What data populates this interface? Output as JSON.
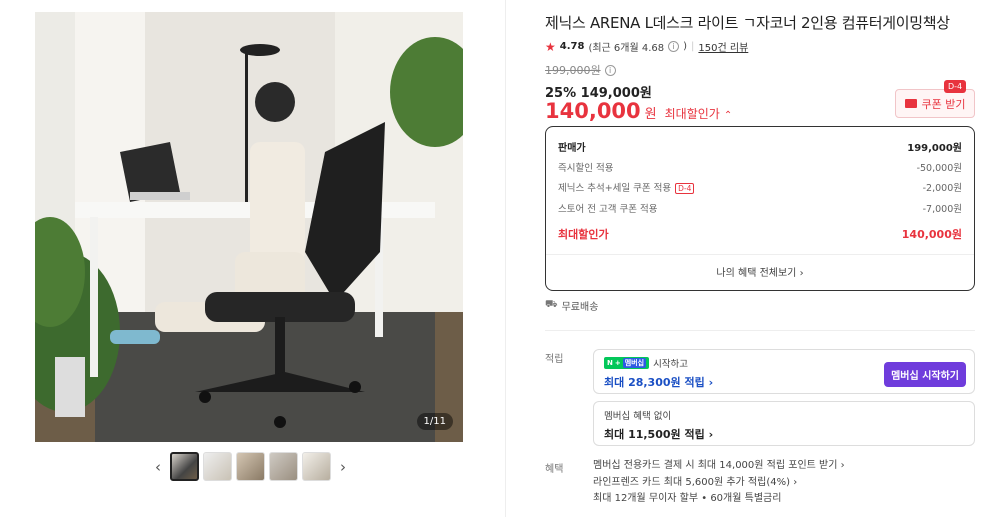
{
  "gallery": {
    "counter": "1/11",
    "prev_icon": "‹",
    "next_icon": "›",
    "thumb_count": 5
  },
  "product": {
    "title": "제닉스 ARENA L데스크 라이트 ㄱ자코너 2인용 컴퓨터게이밍책상",
    "rating": "4.78",
    "rating_recent": "(최근 6개월 4.68",
    "rating_recent_close": ")",
    "review_count": "150건 리뷰",
    "original_price": "199,000원",
    "discount_percent": "25%",
    "discount_price": "149,000원",
    "final_price": "140,000",
    "final_won": "원",
    "final_label": "최대할인가"
  },
  "coupon": {
    "label": "쿠폰 받기",
    "badge": "D-4"
  },
  "price_box": {
    "rows": [
      {
        "label": "판매가",
        "value": "199,000원"
      },
      {
        "label": "즉시할인 적용",
        "value": "-50,000원"
      },
      {
        "label": "제닉스 추석+세일 쿠폰 적용",
        "tag": "D-4",
        "value": "-2,000원"
      },
      {
        "label": "스토어 전 고객 쿠폰 적용",
        "value": "-7,000원"
      }
    ],
    "max_label": "최대할인가",
    "max_value": "140,000원",
    "footer": "나의 혜택 전체보기"
  },
  "shipping": {
    "label": "무료배송"
  },
  "points": {
    "label": "적립",
    "card1_small": "시작하고",
    "card1_badge_n": "N",
    "card1_badge_plus": "+",
    "card1_badge_mem": "멤버십",
    "card1_big": "최대 28,300원 적립",
    "card1_button": "멤버십 시작하기",
    "card2_small": "멤버십 혜택 없이",
    "card2_big": "최대 11,500원 적립"
  },
  "benefits": {
    "label": "혜택",
    "lines": [
      "멤버십 전용카드 결제 시 최대 14,000원 적립 포인트 받기",
      "라인프렌즈 카드 최대 5,600원 추가 적립(4%)",
      "최대 12개월 무이자 할부 • 60개월 특별금리"
    ]
  },
  "colors": {
    "accent": "#e8333e",
    "membership": "#6f3cdc",
    "point_blue": "#1a4fc4"
  }
}
